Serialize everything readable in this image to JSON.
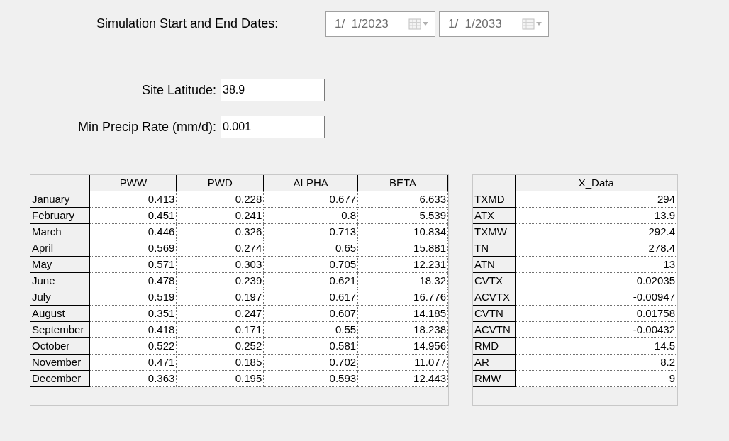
{
  "dates": {
    "label": "Simulation Start and End Dates:",
    "disabled": true,
    "pickers": [
      {
        "value": "1/  1/2023"
      },
      {
        "value": "1/  1/2033"
      }
    ]
  },
  "fields": [
    {
      "label": "Site Latitude:",
      "value": "38.9"
    },
    {
      "label": "Min Precip Rate (mm/d):",
      "value": "0.001"
    }
  ],
  "monthly_table": {
    "columns": [
      "PWW",
      "PWD",
      "ALPHA",
      "BETA"
    ],
    "rows": [
      {
        "label": "January",
        "cells": [
          "0.413",
          "0.228",
          "0.677",
          "6.633"
        ]
      },
      {
        "label": "February",
        "cells": [
          "0.451",
          "0.241",
          "0.8",
          "5.539"
        ]
      },
      {
        "label": "March",
        "cells": [
          "0.446",
          "0.326",
          "0.713",
          "10.834"
        ]
      },
      {
        "label": "April",
        "cells": [
          "0.569",
          "0.274",
          "0.65",
          "15.881"
        ]
      },
      {
        "label": "May",
        "cells": [
          "0.571",
          "0.303",
          "0.705",
          "12.231"
        ]
      },
      {
        "label": "June",
        "cells": [
          "0.478",
          "0.239",
          "0.621",
          "18.32"
        ]
      },
      {
        "label": "July",
        "cells": [
          "0.519",
          "0.197",
          "0.617",
          "16.776"
        ]
      },
      {
        "label": "August",
        "cells": [
          "0.351",
          "0.247",
          "0.607",
          "14.185"
        ]
      },
      {
        "label": "September",
        "cells": [
          "0.418",
          "0.171",
          "0.55",
          "18.238"
        ]
      },
      {
        "label": "October",
        "cells": [
          "0.522",
          "0.252",
          "0.581",
          "14.956"
        ]
      },
      {
        "label": "November",
        "cells": [
          "0.471",
          "0.185",
          "0.702",
          "11.077"
        ]
      },
      {
        "label": "December",
        "cells": [
          "0.363",
          "0.195",
          "0.593",
          "12.443"
        ]
      }
    ]
  },
  "x_table": {
    "columns": [
      "X_Data"
    ],
    "rows": [
      {
        "label": "TXMD",
        "cells": [
          "294"
        ]
      },
      {
        "label": "ATX",
        "cells": [
          "13.9"
        ]
      },
      {
        "label": "TXMW",
        "cells": [
          "292.4"
        ]
      },
      {
        "label": "TN",
        "cells": [
          "278.4"
        ]
      },
      {
        "label": "ATN",
        "cells": [
          "13"
        ]
      },
      {
        "label": "CVTX",
        "cells": [
          "0.02035"
        ]
      },
      {
        "label": "ACVTX",
        "cells": [
          "-0.00947"
        ]
      },
      {
        "label": "CVTN",
        "cells": [
          "0.01758"
        ]
      },
      {
        "label": "ACVTN",
        "cells": [
          "-0.00432"
        ]
      },
      {
        "label": "RMD",
        "cells": [
          "14.5"
        ]
      },
      {
        "label": "AR",
        "cells": [
          "8.2"
        ]
      },
      {
        "label": "RMW",
        "cells": [
          "9"
        ]
      }
    ]
  }
}
